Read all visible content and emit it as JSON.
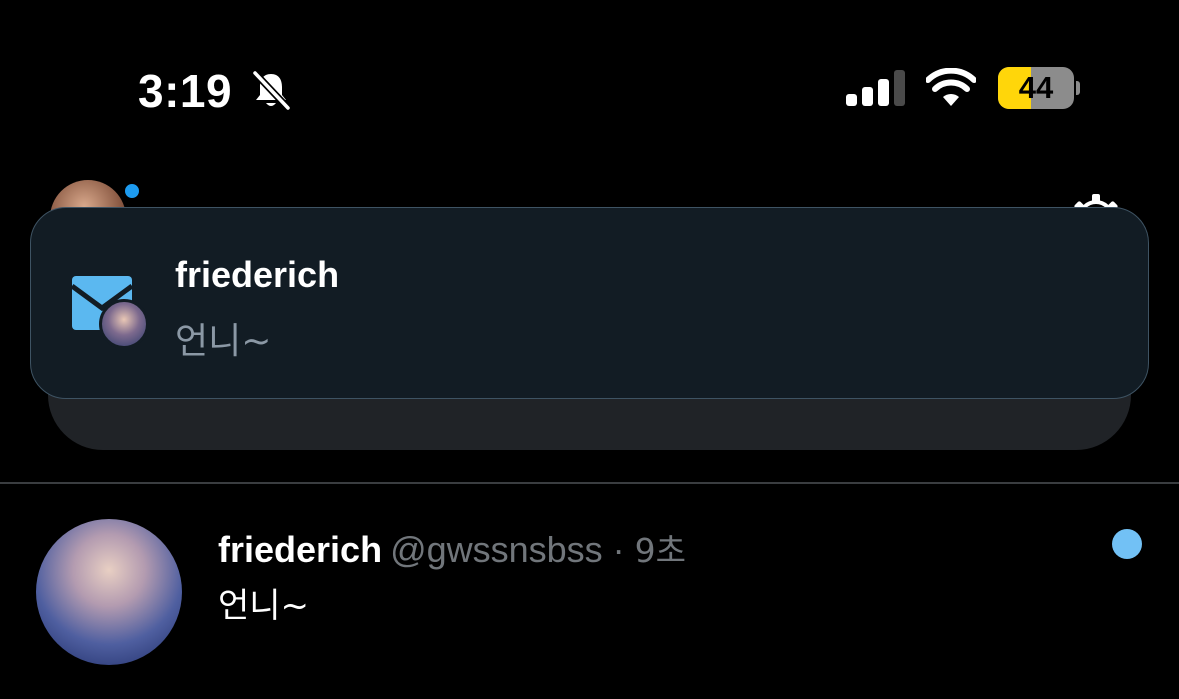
{
  "status_bar": {
    "time": "3:19",
    "battery_percent": "44",
    "battery_level": 0.44,
    "icons": [
      "bell-slash-icon",
      "cellular-signal-icon",
      "wifi-icon",
      "battery-icon"
    ],
    "battery_color": "#ffd60a"
  },
  "header": {
    "icons": [
      "avatar",
      "gear-icon"
    ],
    "accent": "#1d9bf0"
  },
  "notification": {
    "sender": "friederich",
    "body": "언니~",
    "icon": "mail-icon",
    "background": "#121c24"
  },
  "message_row": {
    "name": "friederich",
    "handle": "@gwssnsbss",
    "separator": "·",
    "time": "9초",
    "text": "언니~",
    "unread_color": "#72c1f5"
  }
}
